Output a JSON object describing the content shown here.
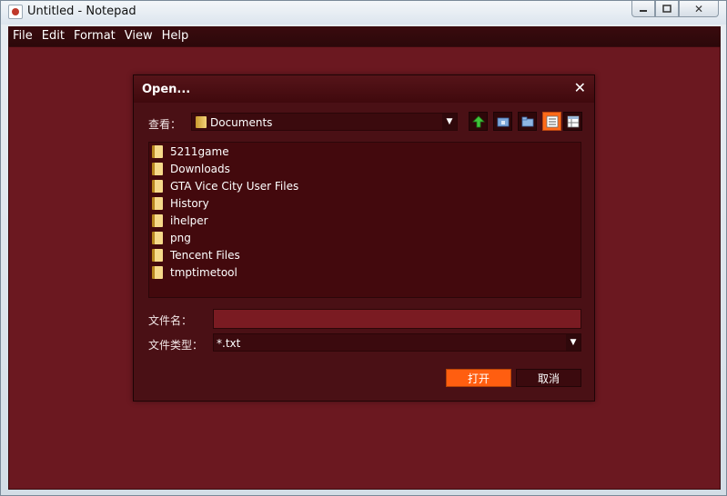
{
  "window": {
    "title": "Untitled - Notepad",
    "controls": {
      "minimize": "▭",
      "maximize": "▢",
      "close": "✕"
    }
  },
  "menubar": {
    "items": [
      "File",
      "Edit",
      "Format",
      "View",
      "Help"
    ]
  },
  "dialog": {
    "title": "Open...",
    "close": "✕",
    "look_in_label": "查看：",
    "look_in_value": "Documents",
    "files": [
      "5211game",
      "Downloads",
      "GTA Vice City User Files",
      "History",
      "ihelper",
      "png",
      "Tencent Files",
      "tmptimetool"
    ],
    "filename_label": "文件名：",
    "filename_value": "",
    "filetype_label": "文件类型：",
    "filetype_value": "*.txt",
    "open_button": "打开",
    "cancel_button": "取消"
  },
  "colors": {
    "editor_bg": "#6b1820",
    "dialog_bg": "#4a1015",
    "accent": "#ff5e10"
  },
  "icons": {
    "up_folder": "up-arrow-icon",
    "home": "home-folder-icon",
    "new_folder": "new-folder-icon",
    "list_view": "list-view-icon",
    "details_view": "details-view-icon"
  }
}
